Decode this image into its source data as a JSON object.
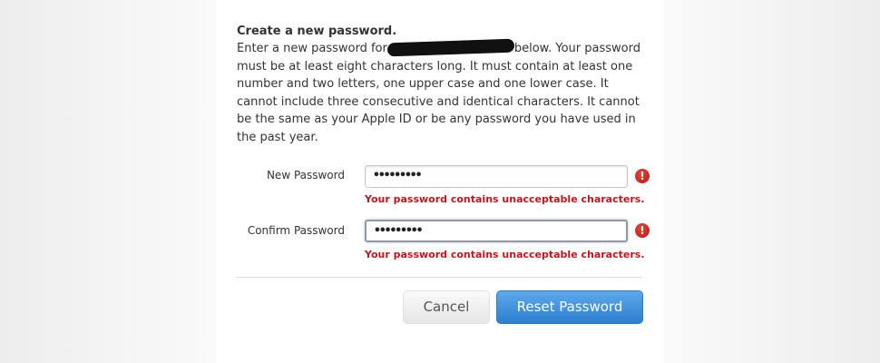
{
  "heading": "Create a new password.",
  "instructions": {
    "line1_before": "Enter a new password for",
    "line1_after": "below. Your password",
    "line2": "must be at least eight characters long. It must contain at least one",
    "line3": "number and two letters, one upper case and one lower case. It",
    "line4": "cannot include three consecutive and identical characters. It cannot",
    "line5": "be the same as your Apple ID or be any password you have used in",
    "line6": "the past year."
  },
  "new_password": {
    "label": "New Password",
    "value": "•••••••••",
    "error": "Your password contains unacceptable characters.",
    "error_icon": "!"
  },
  "confirm_password": {
    "label": "Confirm Password",
    "value": "•••••••••",
    "error": "Your password contains unacceptable characters.",
    "error_icon": "!"
  },
  "buttons": {
    "cancel": "Cancel",
    "reset": "Reset Password"
  },
  "colors": {
    "error_red": "#c4141b",
    "primary_blue": "#2b7fd0"
  }
}
